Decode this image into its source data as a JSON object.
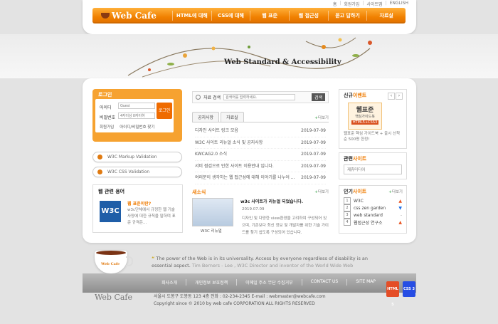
{
  "util_links": [
    "홈",
    "회원가입",
    "사이트맵",
    "ENGLISH"
  ],
  "brand": "Web Cafe",
  "nav": [
    "HTML에 대해",
    "CSS에 대해",
    "웹 표준",
    "웹 접근성",
    "묻고 답하기",
    "자료실"
  ],
  "banner_title": "Web Standard & Accessibility",
  "login": {
    "title": "로그인",
    "id_label": "아이디",
    "pw_label": "비밀번호",
    "id_placeholder": "Guest",
    "pw_placeholder": "4자이상 8자이하",
    "submit": "로그인",
    "join": "회원가입",
    "find": "아이디/비밀번호 찾기"
  },
  "validation": [
    "W3C Markup Validation",
    "W3C CSS Validation"
  ],
  "web_terms": {
    "title": "웹 관련 용어",
    "logo": "W3C",
    "term": "웹 표준이란?",
    "desc": "w3c단체에서 규정한 웹 기술 사양에 대한 규칙을 말하며 표준 규격은..."
  },
  "search": {
    "label": "자료 검색",
    "placeholder": "검색어를 입력하세요.",
    "button": "검색"
  },
  "tabs": [
    "공지사항",
    "자료실"
  ],
  "more": "더보기",
  "notices": [
    {
      "title": "디자인 사이트 링크 모음",
      "date": "2019-07-09"
    },
    {
      "title": "W3C 사이트 리뉴얼 소식 및 공지사항",
      "date": "2019-07-09"
    },
    {
      "title": "KWCAG2.0 소식",
      "date": "2019-07-09"
    },
    {
      "title": "서비 점검으로 인한 사이트 이용안내 입니다.",
      "date": "2019-07-09"
    },
    {
      "title": "여러분이 생각하는 웹 접근성에 대해 이야기를 나누어 ...",
      "date": "2019-07-09"
    }
  ],
  "news": {
    "title": "새소식",
    "headline": "w3c 사이트가 리뉴얼 되었습니다.",
    "date": "2019.07.09",
    "body": "디자인 및 다양한 view환경을 고려하여 구성되어 있으며, 기존보다 최신 정보 및 개발자를 위한 기술 가이드를 찾기 쉽도록 구성되어 있습니다.",
    "thumb_caption": "W3C 리뉴얼"
  },
  "new_event": {
    "title_a": "신규",
    "title_b": "이벤트",
    "book_title": "웹표준",
    "book_sub": "핵심가이드북",
    "book_tag": "HTML5+CSS3",
    "desc": "웹표준 핵심 가이드북 + 출시 선착순 500명 한정!"
  },
  "related": {
    "title_a": "관련",
    "title_b": "사이트",
    "item": "제휴미디어"
  },
  "popular": {
    "title_a": "인기",
    "title_b": "사이트",
    "items": [
      {
        "n": "1",
        "name": "W3C",
        "trend": "up"
      },
      {
        "n": "2",
        "name": "css zen garden",
        "trend": "down"
      },
      {
        "n": "3",
        "name": "web standard",
        "trend": "-"
      },
      {
        "n": "4",
        "name": "웹접근성 연구소",
        "trend": "up"
      }
    ]
  },
  "quote": {
    "text": "The power of the Web is in its universality. Access by everyone regardless of disability is an essential aspect.",
    "author": "Tim Berners - Lee , W3C Director and inventor of the World Wide Web"
  },
  "footer_links": [
    "회사소개",
    "개인정보 보호정책",
    "이메일 주소 무단 수집거부",
    "CONTACT US",
    "SITE MAP"
  ],
  "address": "서울시 도봉구 도봉동 123 4층   전화 : 02-234-2345   E-mail : webmaster@webcafe.com",
  "copyright": "Copyright since © 2010 by web cafe CORPORATION ALL RIGHTS RESERVED",
  "badges": [
    "HTML 5",
    "CSS 3"
  ],
  "cup_label": "Web Cafe"
}
